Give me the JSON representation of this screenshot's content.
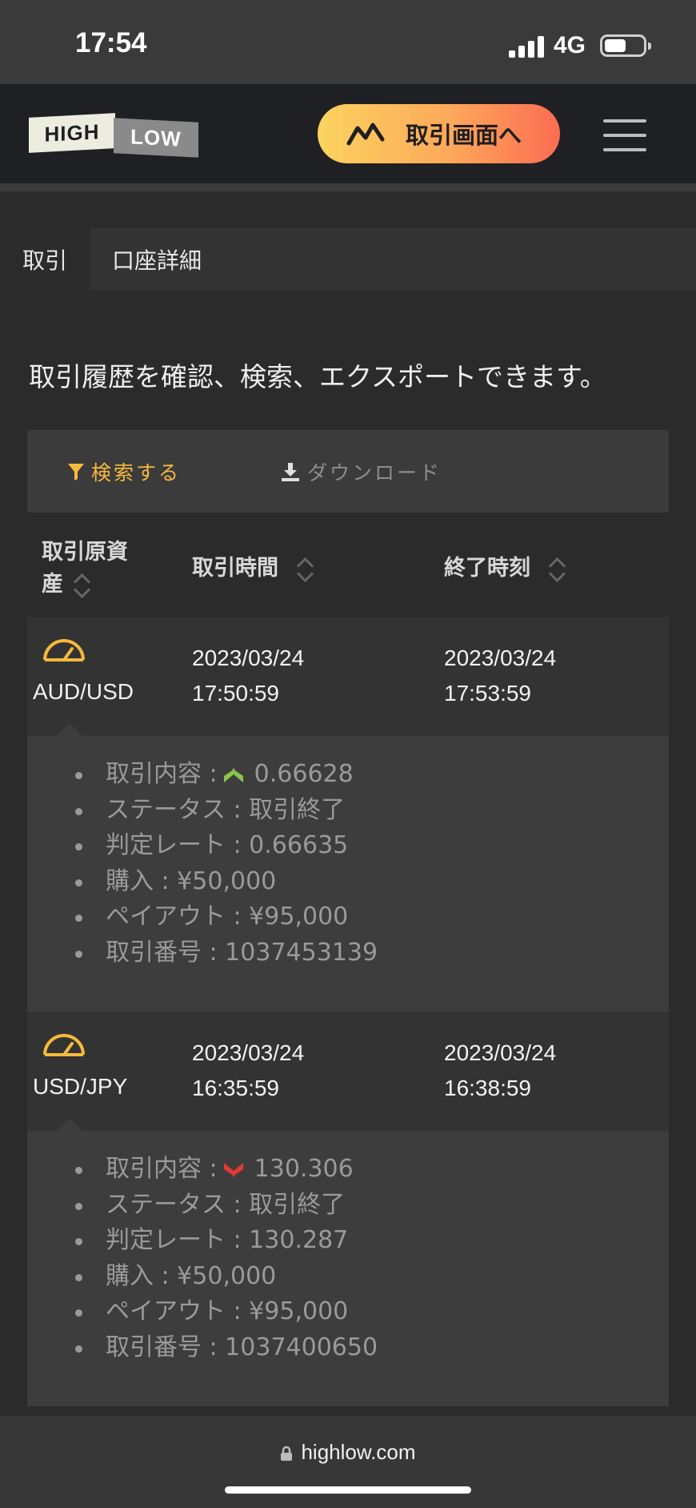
{
  "status": {
    "time": "17:54",
    "network": "4G"
  },
  "header": {
    "logo_high": "HIGH",
    "logo_low": "LOW",
    "trade_button": "取引画面へ"
  },
  "tabs": [
    "取引",
    "口座詳細"
  ],
  "intro": "取引履歴を確認、検索、エクスポートできます。",
  "toolbar": {
    "search": "検索する",
    "download": "ダウンロード"
  },
  "table_head": {
    "asset": [
      "取引原資",
      "産"
    ],
    "trade_time": "取引時間",
    "end_time": "終了時刻"
  },
  "trades": [
    {
      "asset": "AUD/USD",
      "trade_date": "2023/03/24",
      "trade_clock": "17:50:59",
      "end_date": "2023/03/24",
      "end_clock": "17:53:59",
      "direction": "high",
      "details": {
        "content_label": "取引内容 :",
        "content_value": "0.66628",
        "status": "ステータス : 取引終了",
        "rate": "判定レート : 0.66635",
        "purchase": "購入 : ¥50,000",
        "payout": "ペイアウト : ¥95,000",
        "number": "取引番号 : 1037453139"
      }
    },
    {
      "asset": "USD/JPY",
      "trade_date": "2023/03/24",
      "trade_clock": "16:35:59",
      "end_date": "2023/03/24",
      "end_clock": "16:38:59",
      "direction": "low",
      "details": {
        "content_label": "取引内容 :",
        "content_value": "130.306",
        "status": "ステータス : 取引終了",
        "rate": "判定レート : 130.287",
        "purchase": "購入 : ¥50,000",
        "payout": "ペイアウト : ¥95,000",
        "number": "取引番号 : 1037400650"
      }
    }
  ],
  "footer": {
    "url": "highlow.com"
  },
  "colors": {
    "accent": "#f6b93b",
    "high": "#8bc34a",
    "low": "#e53935"
  }
}
